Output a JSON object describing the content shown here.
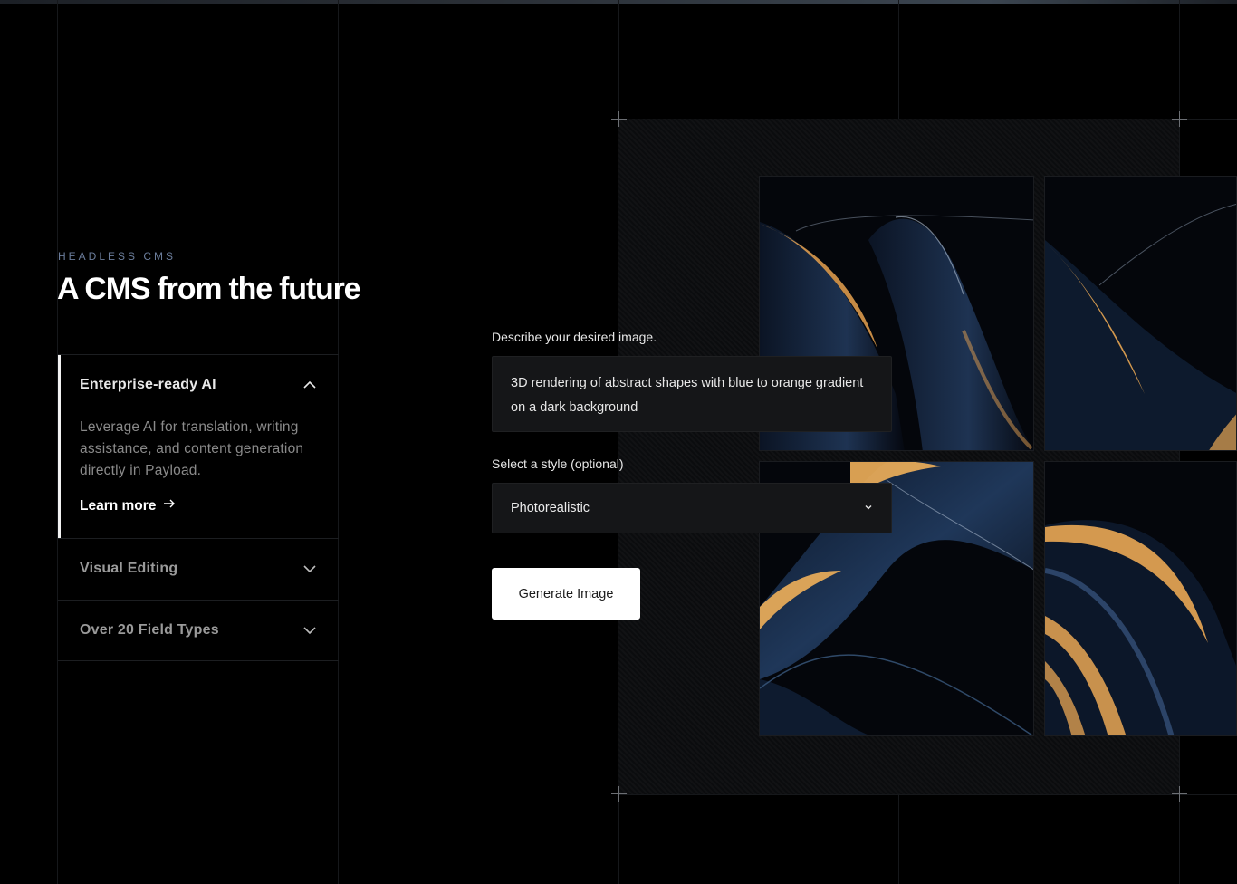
{
  "hero": {
    "eyebrow": "HEADLESS CMS",
    "title": "A CMS from the future"
  },
  "accordion": {
    "items": [
      {
        "title": "Enterprise-ready AI",
        "state": "expanded",
        "icon": "chevron-up-icon",
        "body": "Leverage AI for translation, writing assistance, and content generation directly in Payload.",
        "link": "Learn more",
        "link_icon": "arrow-right-icon"
      },
      {
        "title": "Visual Editing",
        "state": "collapsed",
        "icon": "chevron-down-icon"
      },
      {
        "title": "Over 20 Field Types",
        "state": "collapsed",
        "icon": "chevron-down-icon"
      }
    ]
  },
  "generator": {
    "prompt_label": "Describe your desired image.",
    "prompt_value": "3D rendering of abstract shapes with blue to orange  gradient on a dark background",
    "style_label": "Select a style (optional)",
    "style_value": "Photorealistic",
    "button": "Generate Image"
  },
  "colors": {
    "background": "#000000",
    "field_bg": "#151618",
    "eyebrow": "#6b7d9b",
    "accent_orange": "#f0a64a",
    "accent_blue": "#1d3558"
  }
}
